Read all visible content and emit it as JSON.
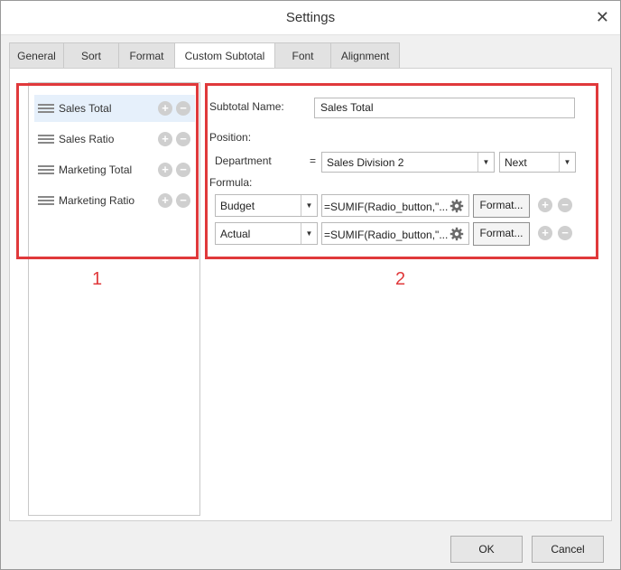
{
  "window": {
    "title": "Settings",
    "close_symbol": "✕"
  },
  "tabs": [
    {
      "label": "General"
    },
    {
      "label": "Sort"
    },
    {
      "label": "Format"
    },
    {
      "label": "Custom Subtotal"
    },
    {
      "label": "Font"
    },
    {
      "label": "Alignment"
    }
  ],
  "active_tab": "Custom Subtotal",
  "subtotals": [
    {
      "label": "Sales Total"
    },
    {
      "label": "Sales Ratio"
    },
    {
      "label": "Marketing Total"
    },
    {
      "label": "Marketing Ratio"
    }
  ],
  "annotations": {
    "box1": "1",
    "box2": "2",
    "color": "#e0393b"
  },
  "form": {
    "subtotal_name_label": "Subtotal Name:",
    "subtotal_name_value": "Sales Total",
    "position_label": "Position:",
    "department_label": "Department",
    "equals": "=",
    "department_value": "Sales Division 2",
    "position_value": "Next",
    "formula_label": "Formula:",
    "formulas": [
      {
        "field": "Budget",
        "expr": "=SUMIF(Radio_button,\"...",
        "format_label": "Format..."
      },
      {
        "field": "Actual",
        "expr": "=SUMIF(Radio_button,\"...",
        "format_label": "Format..."
      }
    ]
  },
  "icons": {
    "add": "plus-circle-icon",
    "remove": "minus-circle-icon",
    "drag": "drag-handle-icon",
    "settings": "gear-icon"
  },
  "footer": {
    "ok": "OK",
    "cancel": "Cancel"
  }
}
